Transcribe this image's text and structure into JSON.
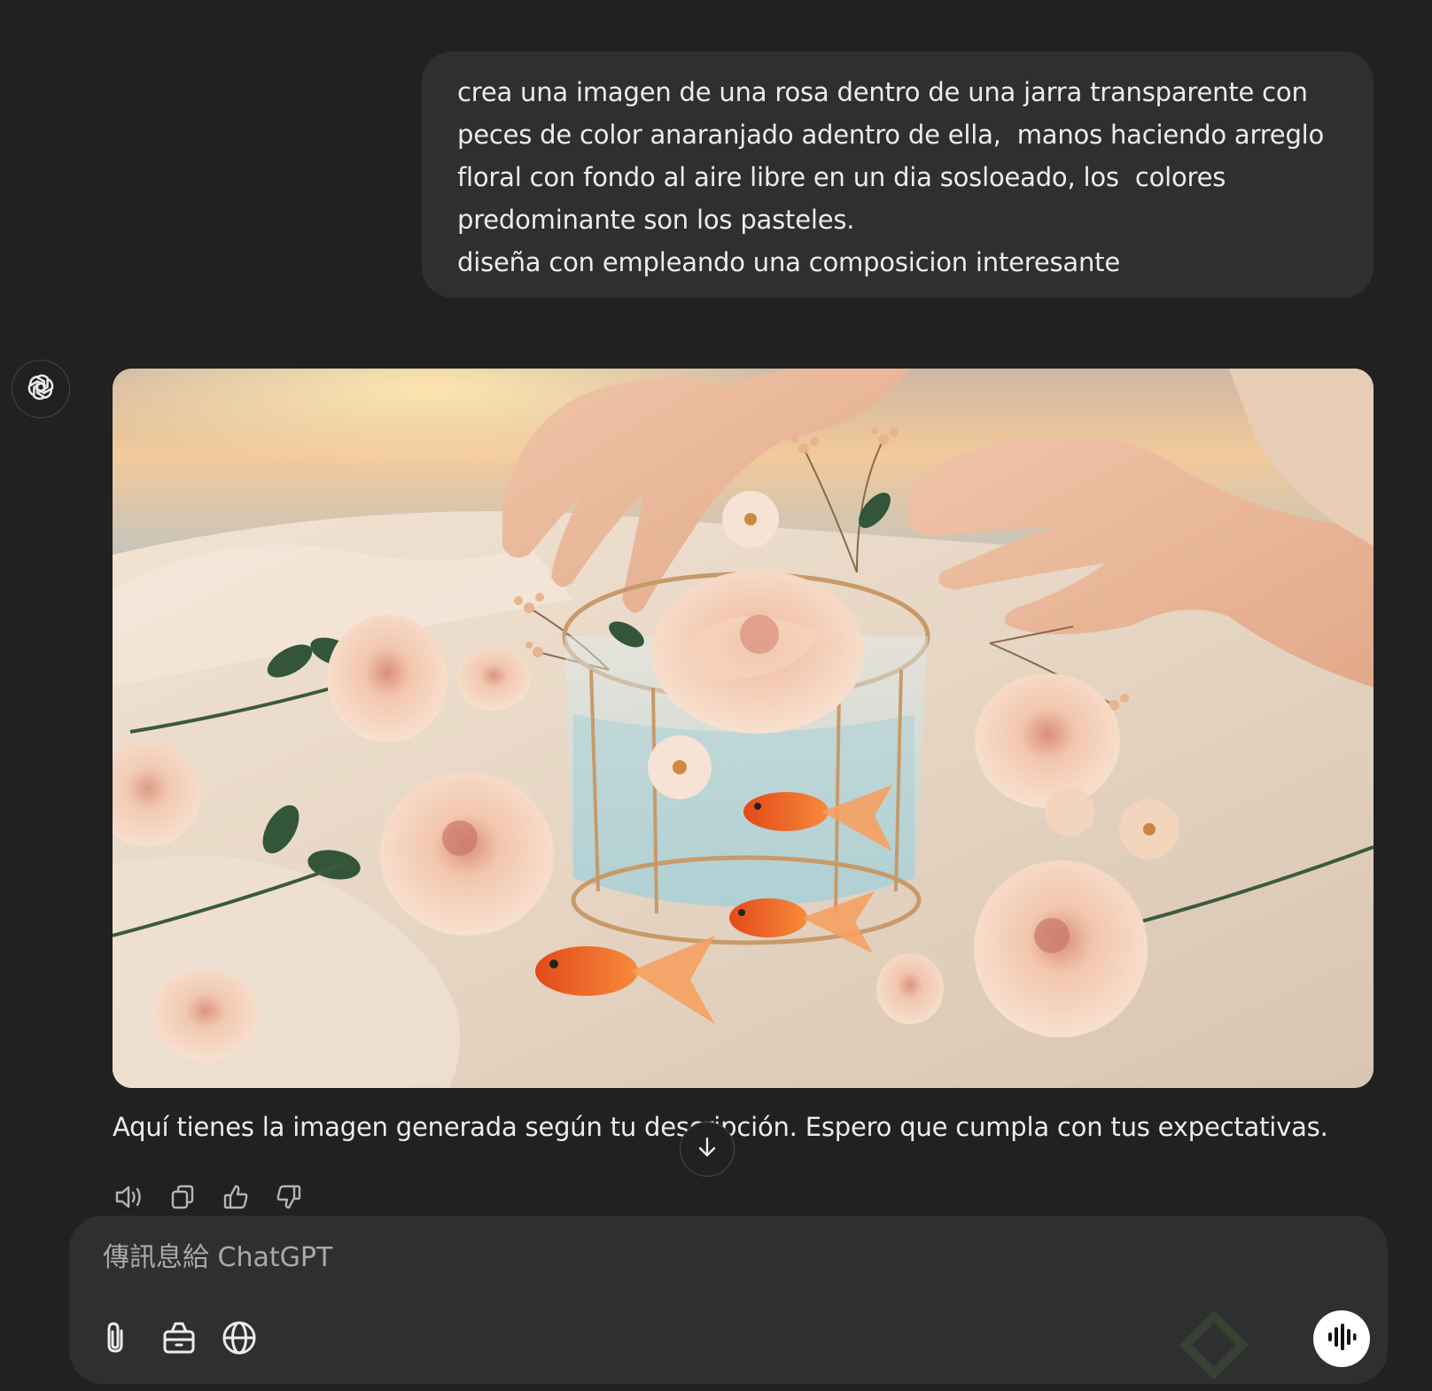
{
  "user_message": {
    "lines": [
      "crea una imagen de una rosa dentro de una jarra transparente con",
      "peces de color anaranjado adentro de ella,  manos haciendo arreglo",
      "floral con fondo al aire libre en un dia sosloeado, los  colores",
      "predominante son los pasteles.",
      "diseña con empleando una composicion interesante"
    ]
  },
  "assistant": {
    "avatar_icon": "openai-logo-icon",
    "image_subject": "roses-glass-jar-goldfish-hands",
    "reply_text": "Aquí tienes la imagen generada según tu descripción. Espero que cumpla con tus expectativas.",
    "actions": [
      {
        "icon": "speaker-icon"
      },
      {
        "icon": "copy-icon"
      },
      {
        "icon": "thumbs-up-icon"
      },
      {
        "icon": "thumbs-down-icon"
      }
    ]
  },
  "scroll_button": {
    "icon": "arrow-down-icon"
  },
  "composer": {
    "placeholder": "傳訊息給 ChatGPT",
    "value": "",
    "tools": [
      {
        "icon": "paperclip-icon"
      },
      {
        "icon": "toolbox-icon"
      },
      {
        "icon": "globe-icon"
      }
    ],
    "voice_icon": "voice-waveform-icon"
  },
  "colors": {
    "background": "#212121",
    "bubble": "#2f2f2f",
    "text": "#ececec",
    "placeholder": "#a9a9a9"
  }
}
